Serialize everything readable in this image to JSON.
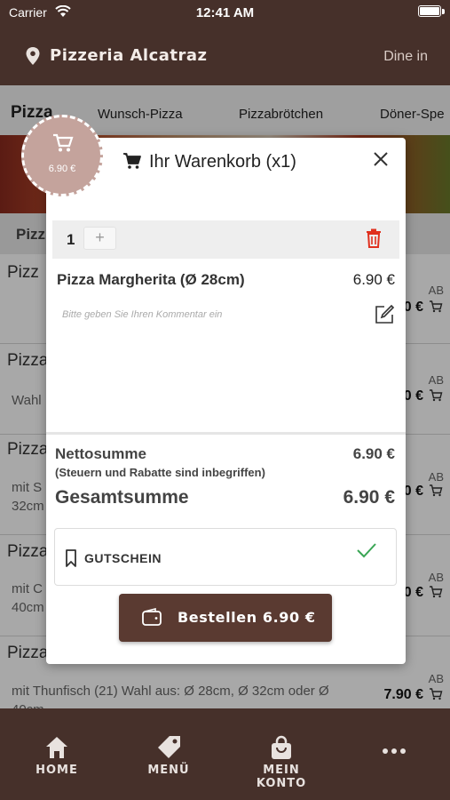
{
  "status_bar": {
    "carrier": "Carrier",
    "time": "12:41 AM"
  },
  "header": {
    "restaurant": "Pizzeria Alcatraz",
    "mode": "Dine in"
  },
  "tabs": [
    "Pizza",
    "Wunsch-Pizza",
    "Pizzabrötchen",
    "Döner-Spe"
  ],
  "list": {
    "section_title": "Pizz",
    "items": [
      {
        "title": "Pizz",
        "desc": "",
        "ab": "AB",
        "price": "0 €"
      },
      {
        "title": "Pizza",
        "desc": "Wahl",
        "ab": "AB",
        "price": "0 €"
      },
      {
        "title": "Pizza",
        "desc": "mit S",
        "desc2": "32cm",
        "ab": "AB",
        "price": "0 €"
      },
      {
        "title": "Pizza",
        "desc": "mit C",
        "desc2": "40cm",
        "ab": "AB",
        "price": "0 €"
      },
      {
        "title": "Pizza",
        "desc": "mit Thunfisch (21) Wahl aus: Ø 28cm, Ø 32cm oder Ø",
        "desc2": "40cm",
        "ab": "AB",
        "price": "7.90 €"
      }
    ]
  },
  "cart_badge": {
    "amount": "6.90 €"
  },
  "modal": {
    "title": "Ihr Warenkorb (x1)",
    "quantity": "1",
    "plus": "+",
    "item_name": "Pizza Margherita (Ø 28cm)",
    "item_price": "6.90 €",
    "comment_placeholder": "Bitte geben Sie Ihren Kommentar ein",
    "net_label": "Nettosumme",
    "net_note": "(Steuern und Rabatte sind inbegriffen)",
    "net_value": "6.90 €",
    "total_label": "Gesamtsumme",
    "total_value": "6.90 €",
    "voucher_label": "GUTSCHEIN",
    "order_label": "Bestellen 6.90 €"
  },
  "bottom_nav": [
    {
      "label": "HOME",
      "icon": "home-icon"
    },
    {
      "label": "MENÜ",
      "icon": "tag-icon"
    },
    {
      "label": "MEIN KONTO",
      "icon": "bag-icon"
    },
    {
      "label": "",
      "icon": "more-icon"
    }
  ],
  "colors": {
    "brand": "#46302a",
    "button": "#5a3a31",
    "badge": "#c4a39c",
    "delete": "#e0301e",
    "check": "#3aa655"
  }
}
